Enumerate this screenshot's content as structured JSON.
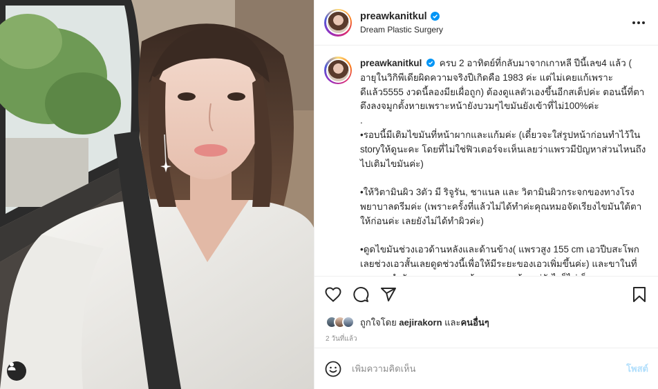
{
  "post": {
    "author": {
      "username": "preawkanitkul",
      "verified": true,
      "location": "Dream Plastic Surgery"
    },
    "caption": {
      "username": "preawkanitkul",
      "lines": [
        "ครบ 2 อาทิตย์ที่กลับมาจากเกาหลี ปีนี้เลข4 แล้ว ( อายุในวิกิพีเดียผิดความจริงปีเกิดคือ 1983 ค่ะ แต่ไม่เคยแก้เพราะดีแล้ว5555 งวดนี้ลองมียเผื่อถูก) ต้องดูแลตัวเองขึ้นอีกสเต็ปค่ะ ตอนนี้ที่ตาตึงลงจมูกตั้งหายเพราะหน้ายังบวมๆไขมันยังเข้าที่ไม่100%ค่ะ",
        ".",
        "•รอบนี้มีเติมไขมันที่หน้าผากและแก้มค่ะ (เดี๋ยวจะใส่รูปหน้าก่อนทำไว้ใน storyให้ดูนะคะ โดยที่ไม่ใช่ฟิวเตอร์จะเห็นเลยว่าแพรวมีปัญหาส่วนไหนถึงไปเติมไขมันค่ะ)",
        "",
        "•ให้วิตามินผิว 3ตัว มี ริจูรัน, ชาแนล และ วิตามินผิวกระจกของทางโรงพยาบาลดรีมค่ะ (เพราะครั้งที่แล้วไม่ได้ทำค่ะคุณหมอจัดเรียงไขมันใต้ตาให้ก่อนค่ะ เลยยังไม่ได้ทำผิวค่ะ)",
        "",
        "•ดูดไขมันช่วงเอวด้านหลังและด้านข้าง( แพรวสูง 155 cm เอวปีบสะโพกเลยช่วงเอวสั้นเลยดูดช่วงนี้เพื่อให้มีระยะของเอวเพิ่มขึ้นค่ะ) และขาในที่เราออกกำลังคุมอาหารจนหน้าเราตอบแล้ว แต่ยังไงก็ไม่เล็กลง จากสาวสังมันนี้ริจอิ๊อไปม้อยไม่ต้อยแต่มาวจอมันไม่เล็กค่ะ (แต่ยังไงก็"
      ]
    },
    "likes": {
      "prefix": "ถูกใจโดย ",
      "user": "aejirakorn",
      "middle": " และ",
      "others": "คนอื่นๆ"
    },
    "timestamp": "2 วันที่แล้ว",
    "comment": {
      "placeholder": "เพิ่มความคิดเห็น",
      "post_label": "โพสต์"
    }
  },
  "icons": {
    "more": "more-icon",
    "like": "heart-icon",
    "comment": "comment-icon",
    "share": "send-icon",
    "save": "bookmark-icon",
    "emoji": "emoji-icon",
    "tag": "user-tag-icon"
  },
  "colors": {
    "verified": "#0095f6",
    "post_button_disabled": "#b2dffc",
    "secondary_text": "#8e8e8e"
  }
}
